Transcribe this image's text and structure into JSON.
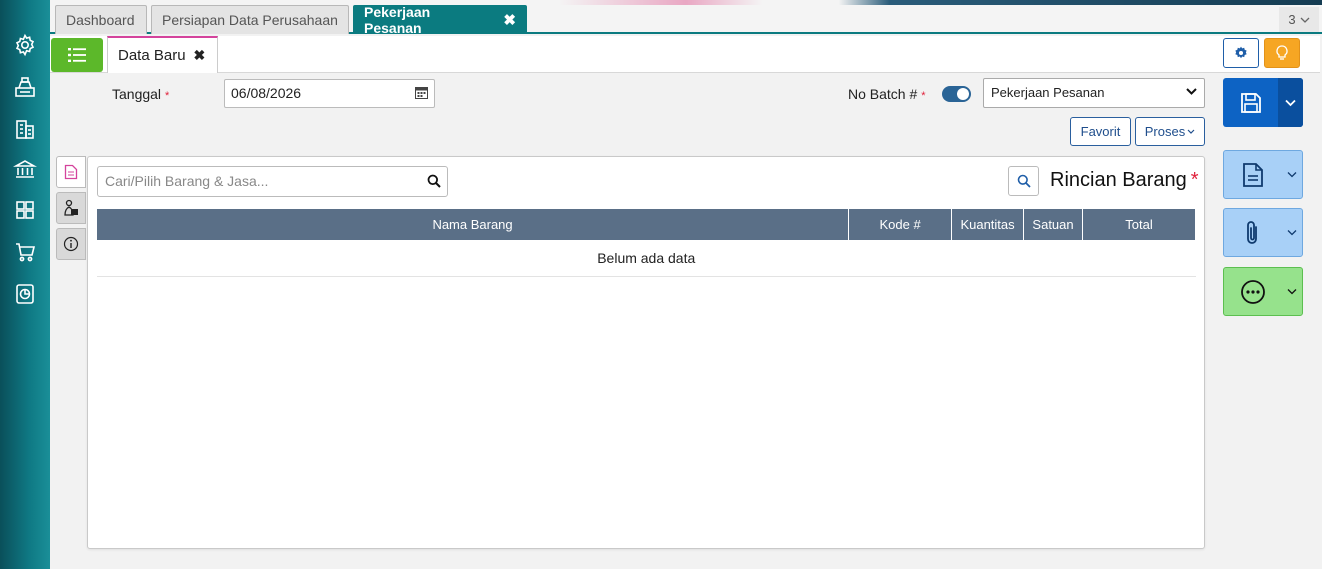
{
  "window_tabs": [
    {
      "label": "Dashboard"
    },
    {
      "label": "Persiapan Data Perusahaan"
    },
    {
      "label": "Pekerjaan Pesanan",
      "active": true
    }
  ],
  "tab_count": "3",
  "sub_tab": {
    "label": "Data Baru"
  },
  "form": {
    "tanggal_label": "Tanggal",
    "tanggal_value": "06/08/2026",
    "required_mark": "*",
    "batch_label": "No Batch #",
    "batch_toggle_on": true,
    "type_select_value": "Pekerjaan Pesanan"
  },
  "buttons": {
    "favorit": "Favorit",
    "proses": "Proses"
  },
  "item_panel": {
    "search_placeholder": "Cari/Pilih Barang & Jasa...",
    "title": "Rincian Barang",
    "title_star": "*",
    "columns": [
      "Nama Barang",
      "Kode #",
      "Kuantitas",
      "Satuan",
      "Total"
    ],
    "empty_text": "Belum ada data"
  },
  "colors": {
    "sidebar": "#0f7a85",
    "active_tab": "#0b7b80",
    "menu_button": "#5cb82a",
    "save_button": "#0d63c4",
    "table_header": "#5a6f87",
    "hint_button": "#f6a623",
    "required": "#e0203a"
  },
  "icons": {
    "sidebar": [
      "gear-icon",
      "cash-register-icon",
      "building-icon",
      "bank-icon",
      "inventory-icon",
      "cart-icon",
      "report-icon"
    ],
    "side_tabs": [
      "document-icon",
      "money-bag-icon",
      "info-icon"
    ],
    "actions": [
      "save-icon",
      "file-icon",
      "paperclip-icon",
      "more-icon"
    ]
  }
}
